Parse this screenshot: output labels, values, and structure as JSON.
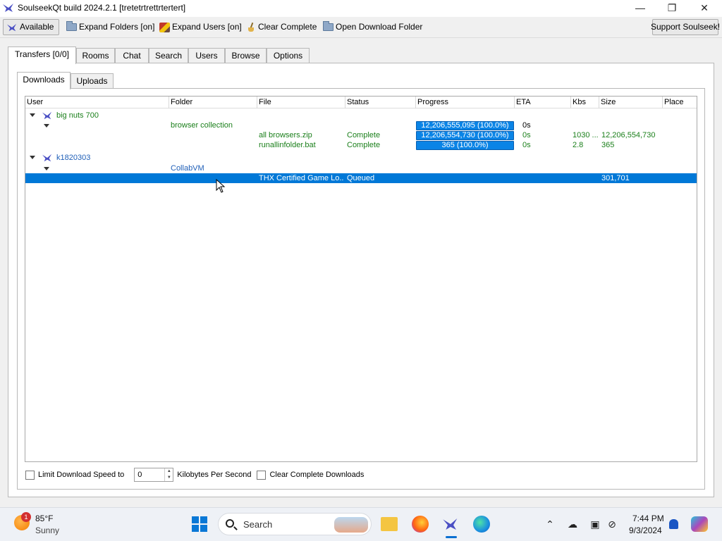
{
  "window": {
    "title": "SoulseekQt build 2024.2.1 [tretetrtrettrtertert]"
  },
  "toolbar": {
    "available": "Available",
    "expand_folders": "Expand Folders [on]",
    "expand_users": "Expand Users [on]",
    "clear_complete": "Clear Complete",
    "open_download_folder": "Open Download Folder",
    "support": "Support Soulseek!"
  },
  "main_tabs": [
    "Transfers [0/0]",
    "Rooms",
    "Chat",
    "Search",
    "Users",
    "Browse",
    "Options"
  ],
  "sub_tabs": [
    "Downloads",
    "Uploads"
  ],
  "columns": [
    "User",
    "Folder",
    "File",
    "Status",
    "Progress",
    "ETA",
    "Kbs",
    "Size",
    "Place"
  ],
  "transfers": {
    "user1": {
      "name": "big nuts 700"
    },
    "folder1": {
      "folder": "browser collection",
      "progress": "12,206,555,095 (100.0%)",
      "eta": "0s"
    },
    "file1": {
      "file": "all browsers.zip",
      "status": "Complete",
      "progress": "12,206,554,730 (100.0%)",
      "eta": "0s",
      "kbs": "1030 ...",
      "size": "12,206,554,730"
    },
    "file2": {
      "file": "runallinfolder.bat",
      "status": "Complete",
      "progress": "365 (100.0%)",
      "eta": "0s",
      "kbs": "2.8",
      "size": "365"
    },
    "user2": {
      "name": "k1820303"
    },
    "folder2": {
      "folder": "CollabVM"
    },
    "file3": {
      "file": "THX Certified Game Lo...",
      "status": "Queued",
      "size": "301,701"
    }
  },
  "options": {
    "limit_label": "Limit Download Speed to",
    "speed_value": "0",
    "speed_unit": "Kilobytes Per Second",
    "clear_label": "Clear Complete Downloads"
  },
  "taskbar": {
    "temp": "85°F",
    "condition": "Sunny",
    "weather_badge": "1",
    "search": "Search",
    "time": "7:44 PM",
    "date": "9/3/2024"
  }
}
